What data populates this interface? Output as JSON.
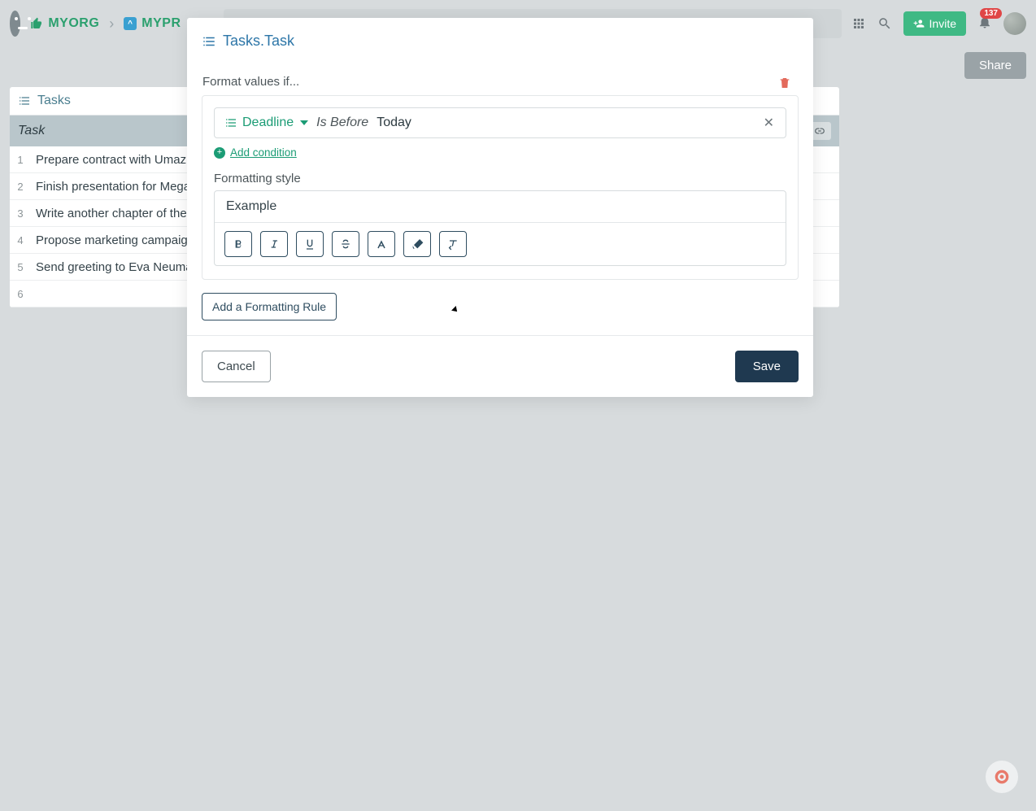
{
  "breadcrumb": {
    "org": "MYORG",
    "project": "MYPR"
  },
  "topbar": {
    "invite_label": "Invite",
    "notif_count": "137"
  },
  "share_label": "Share",
  "grid": {
    "title": "Tasks",
    "column_header": "Task",
    "column_btn": "nn",
    "rows": [
      "Prepare contract with Umazun",
      "Finish presentation for Megaso",
      "Write another chapter of the n",
      "Propose marketing campaign t",
      "Send greeting to Eva Neumann"
    ]
  },
  "modal": {
    "title": "Tasks.Task",
    "rule_label": "Format values if...",
    "condition": {
      "field": "Deadline",
      "operator": "Is Before",
      "value": "Today"
    },
    "add_condition": "Add condition",
    "fmt_label": "Formatting style",
    "example_text": "Example",
    "add_rule_label": "Add a Formatting Rule",
    "cancel_label": "Cancel",
    "save_label": "Save"
  }
}
